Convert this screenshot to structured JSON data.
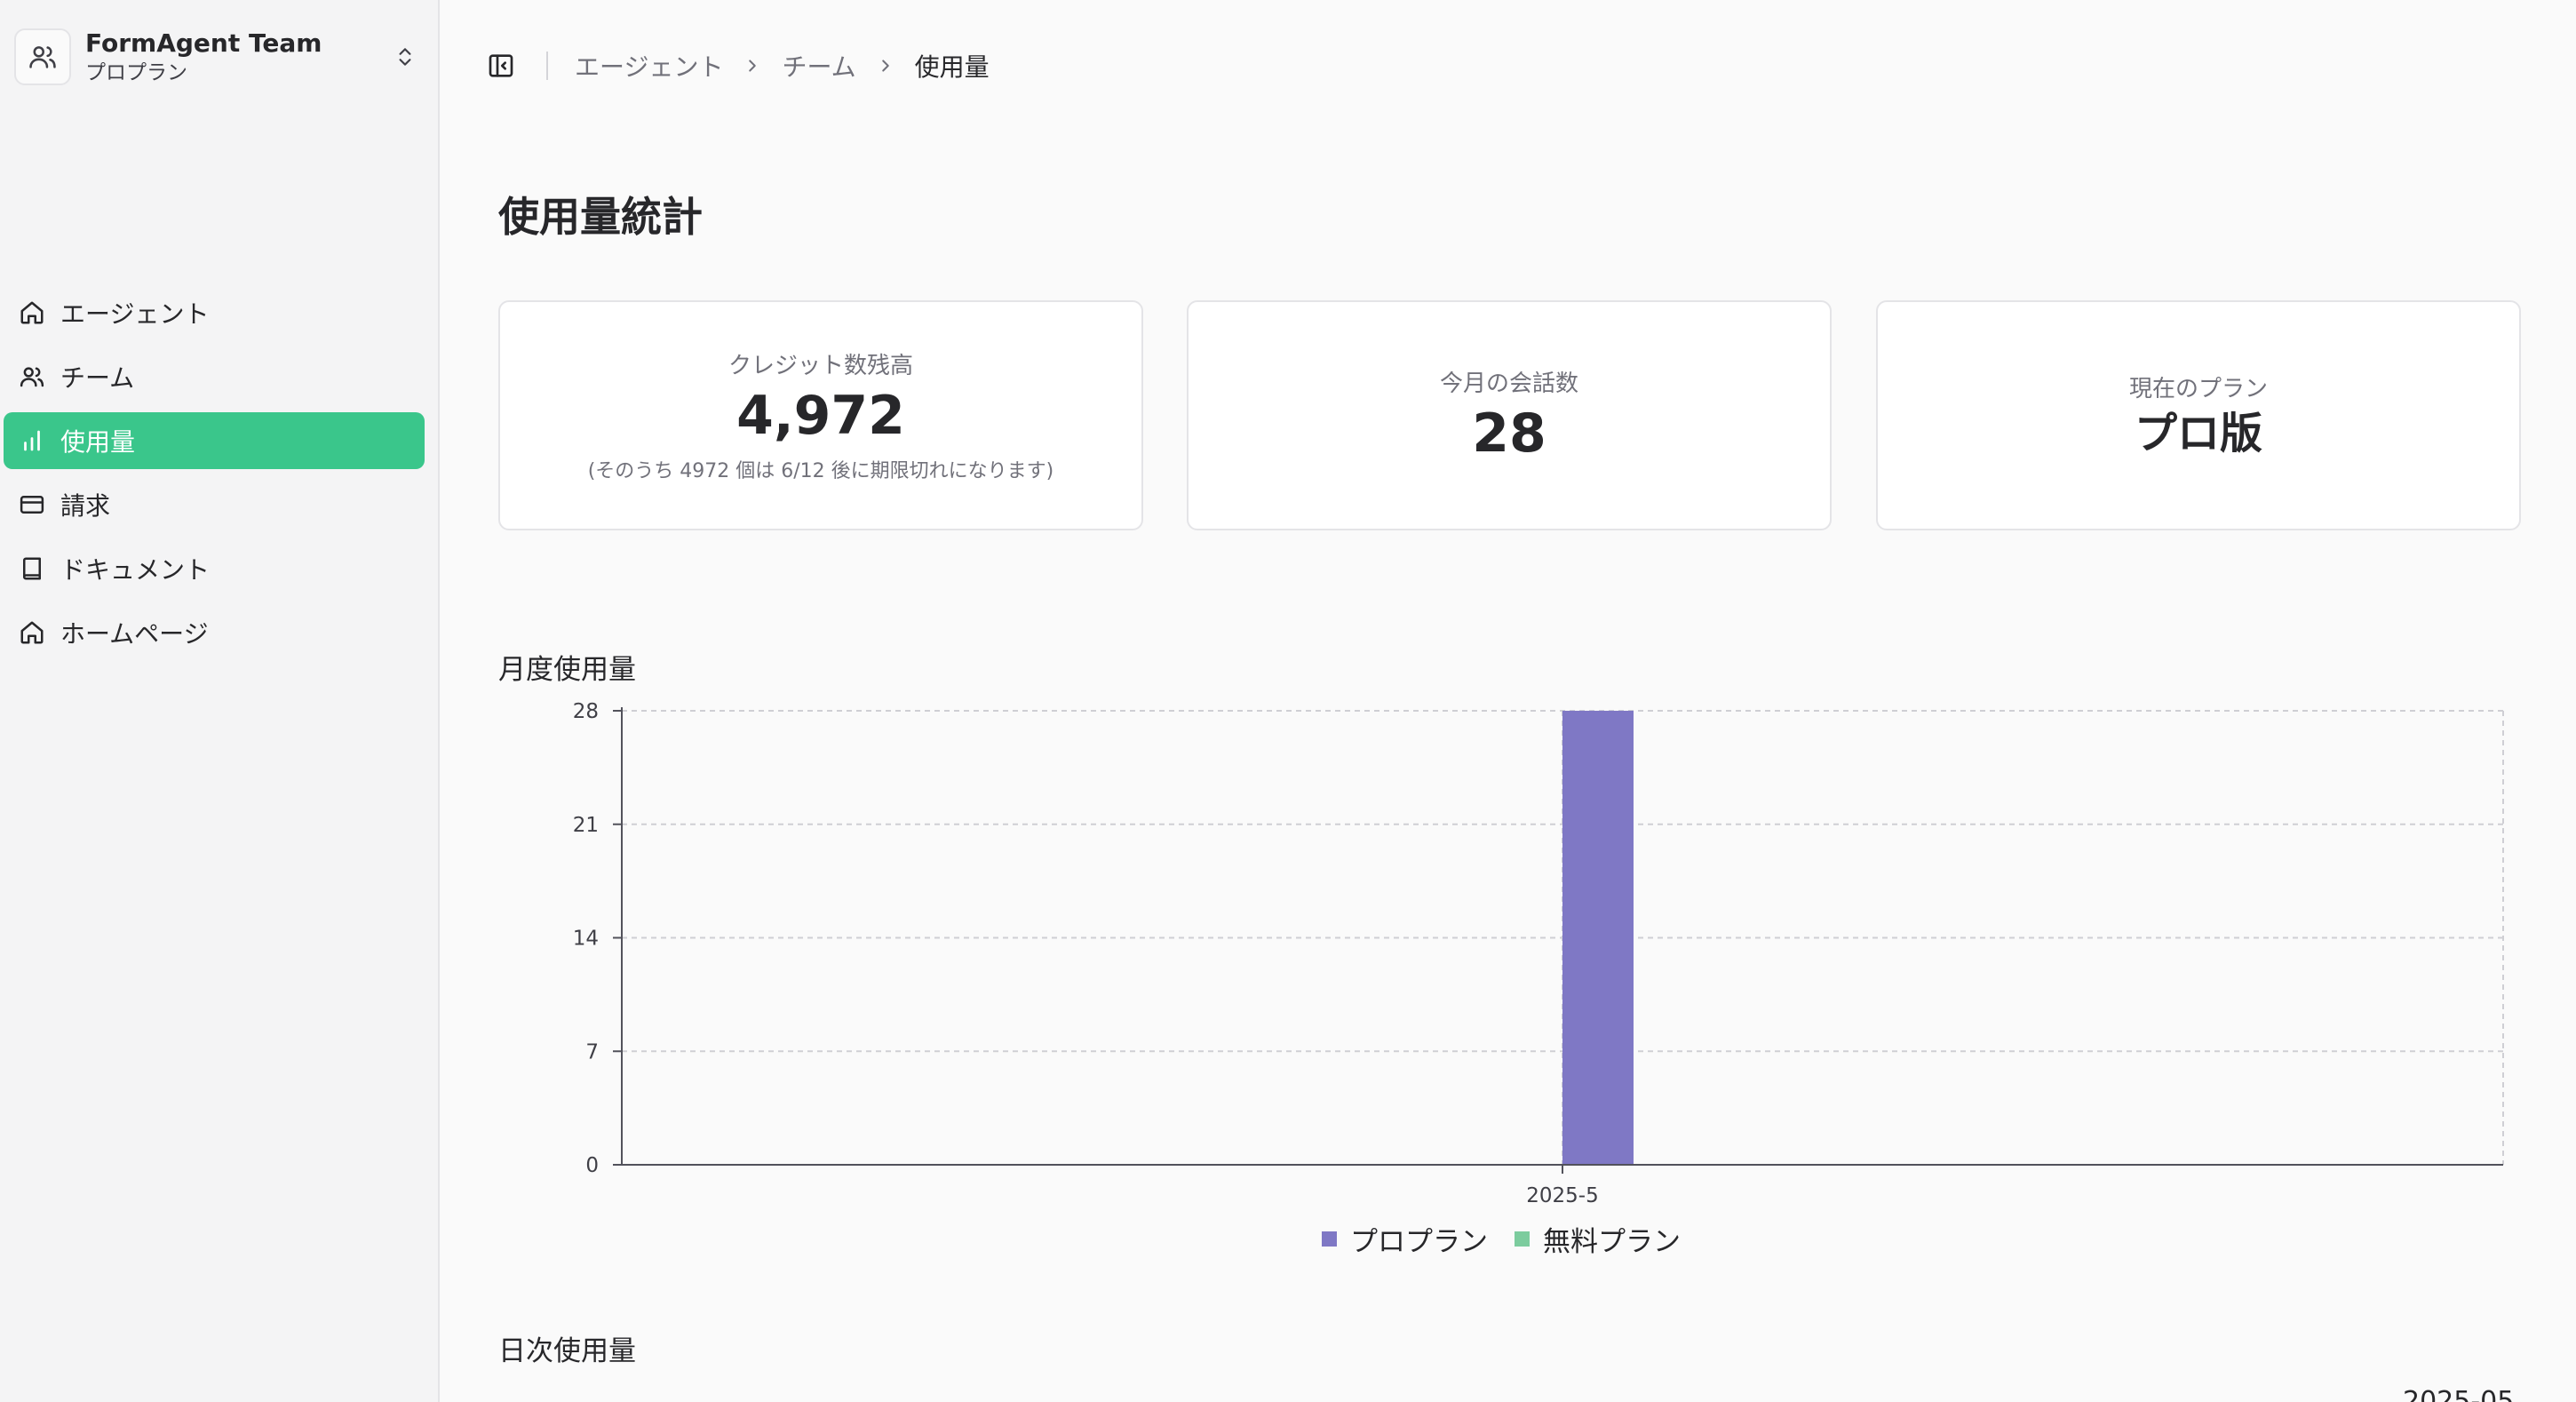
{
  "sidebar": {
    "team": {
      "name": "FormAgent Team",
      "plan": "プロプラン"
    },
    "items": [
      {
        "label": "エージェント",
        "icon": "home-icon"
      },
      {
        "label": "チーム",
        "icon": "users-icon"
      },
      {
        "label": "使用量",
        "icon": "bar-chart-icon",
        "active": true
      },
      {
        "label": "請求",
        "icon": "credit-card-icon"
      },
      {
        "label": "ドキュメント",
        "icon": "book-icon"
      },
      {
        "label": "ホームページ",
        "icon": "home-icon"
      }
    ]
  },
  "breadcrumb": [
    "エージェント",
    "チーム",
    "使用量"
  ],
  "page": {
    "title": "使用量統計"
  },
  "stats": {
    "credits": {
      "label": "クレジット数残高",
      "value": "4,972",
      "note": "(そのうち 4972 個は 6/12 後に期限切れになります)"
    },
    "conversations": {
      "label": "今月の会話数",
      "value": "28"
    },
    "plan": {
      "label": "現在のプラン",
      "value": "プロ版"
    }
  },
  "monthly": {
    "title": "月度使用量"
  },
  "daily": {
    "title": "日次使用量",
    "date_label": "2025-05"
  },
  "colors": {
    "accent": "#3ac68b",
    "pro_series": "#7f78c5",
    "free_series": "#7ccc9e"
  },
  "chart_data": {
    "type": "bar",
    "categories": [
      "2025-5"
    ],
    "series": [
      {
        "name": "プロプラン",
        "values": [
          28
        ],
        "color": "#7f78c5"
      },
      {
        "name": "無料プラン",
        "values": [
          0
        ],
        "color": "#7ccc9e"
      }
    ],
    "yticks": [
      0,
      7,
      14,
      21,
      28
    ],
    "ylim": [
      0,
      28
    ],
    "grid": true,
    "legend": "bottom"
  }
}
